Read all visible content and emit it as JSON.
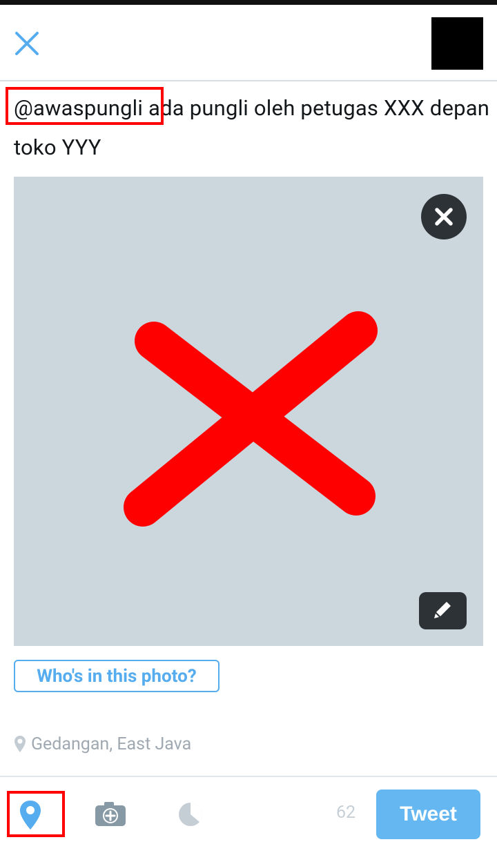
{
  "compose": {
    "mention": "@awaspungli",
    "text_after_mention": " ada pungli oleh petugas XXX depan toko YYY"
  },
  "photo": {
    "tag_label": "Who's in this photo?"
  },
  "location": {
    "label": "Gedangan, East Java"
  },
  "toolbar": {
    "char_count": "62",
    "tweet_label": "Tweet"
  },
  "colors": {
    "accent": "#55acee",
    "tweet_button": "#65b7f1",
    "highlight_box": "#ff0000",
    "photo_bg": "#ccd6dd",
    "icon_gray": "#8899a6"
  },
  "icons": [
    "close-icon",
    "x-mark-icon",
    "pencil-icon",
    "map-pin-icon",
    "camera-add-icon",
    "poll-icon"
  ]
}
